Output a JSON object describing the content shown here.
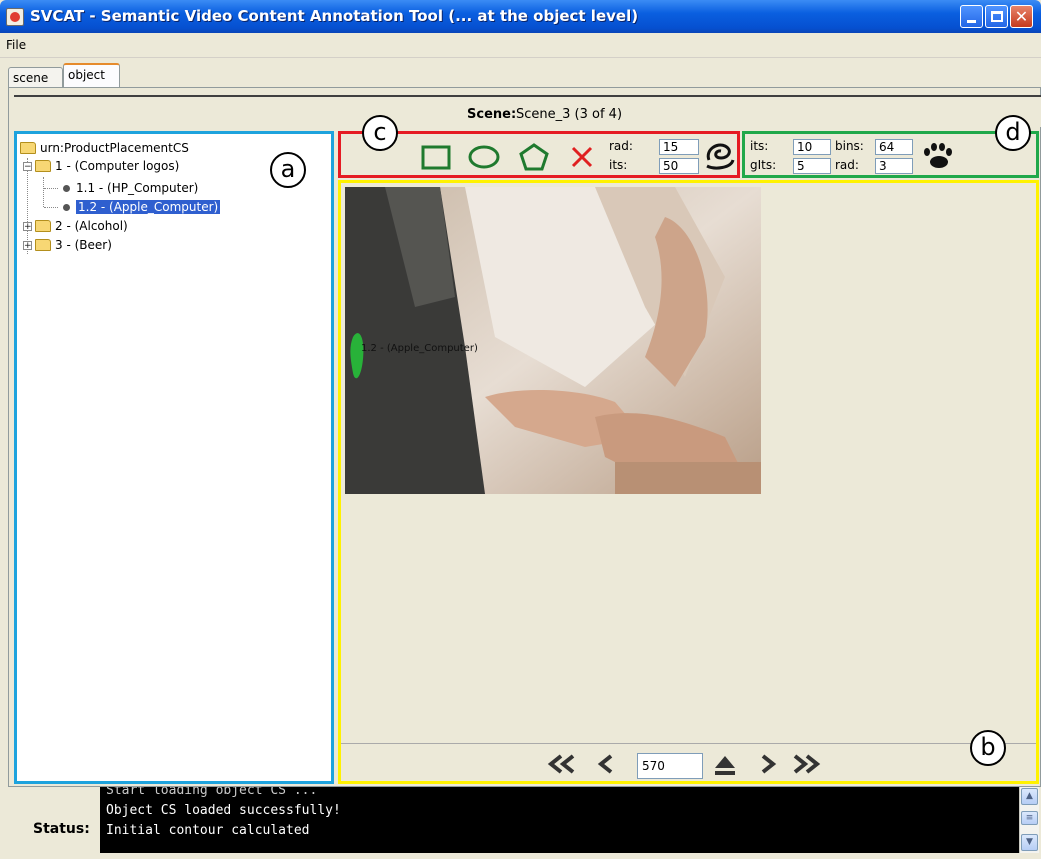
{
  "window": {
    "title": "SVCAT - Semantic Video Content Annotation Tool (... at the object level)"
  },
  "menu": {
    "file": "File"
  },
  "tabs": [
    {
      "label": "scene"
    },
    {
      "label": "object",
      "active": true
    }
  ],
  "scene": {
    "label": "Scene:",
    "value": "Scene_3 (3 of 4)"
  },
  "tree": {
    "root": "urn:ProductPlacementCS",
    "items": [
      {
        "label": "1 - (Computer logos)",
        "expanded": true,
        "children": [
          {
            "label": "1.1 - (HP_Computer)"
          },
          {
            "label": "1.2 - (Apple_Computer)",
            "selected": true
          }
        ]
      },
      {
        "label": "2 - (Alcohol)",
        "expanded": false
      },
      {
        "label": "3 - (Beer)",
        "expanded": false
      }
    ]
  },
  "toolbar_c": {
    "rad_label": "rad:",
    "rad_value": "15",
    "its_label": "its:",
    "its_value": "50",
    "tools": [
      "rectangle-tool",
      "ellipse-tool",
      "polygon-tool",
      "delete-tool",
      "snake-tool"
    ]
  },
  "toolbar_d": {
    "its_label": "its:",
    "its_value": "10",
    "bins_label": "bins:",
    "bins_value": "64",
    "glts_label": "gIts:",
    "glts_value": "5",
    "rad_label": "rad:",
    "rad_value": "3"
  },
  "video": {
    "overlay_label": "1.2 - (Apple_Computer)",
    "frame_number": "570"
  },
  "markers": {
    "a": "a",
    "b": "b",
    "c": "c",
    "d": "d"
  },
  "status": {
    "label": "Status:",
    "lines": [
      "Start loading object CS ...",
      "Object CS loaded successfully!",
      "Initial contour calculated"
    ]
  },
  "colors": {
    "panel_a": "#1ea3dd",
    "panel_b": "#fff200",
    "panel_c": "#e51b23",
    "panel_d": "#20a84a",
    "selection": "#2f5fcf"
  }
}
